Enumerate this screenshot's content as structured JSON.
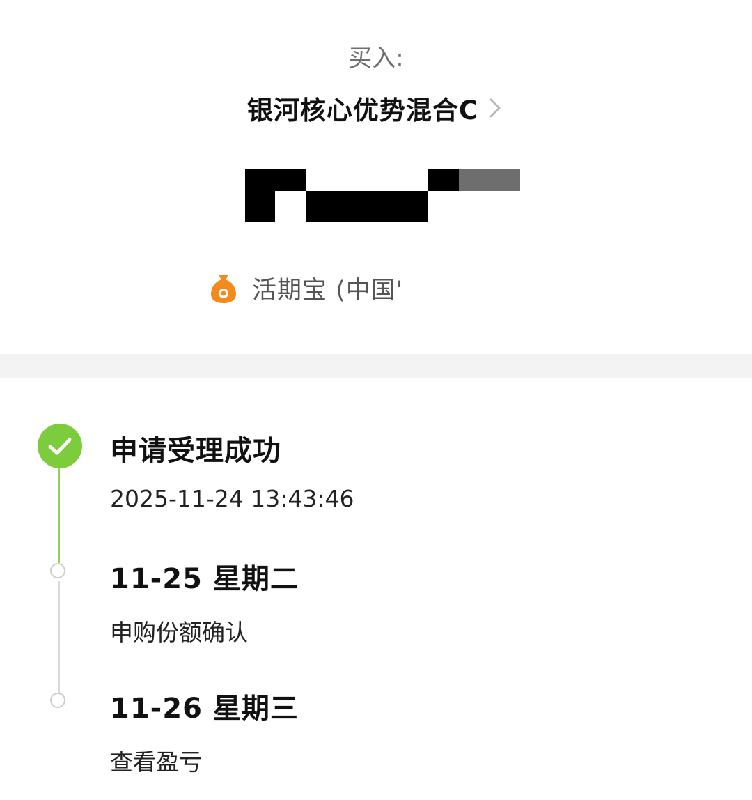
{
  "header": {
    "buy_label": "买入:",
    "fund_name": "银河核心优势混合C"
  },
  "payment": {
    "method_text": "活期宝 (中国'",
    "icon": "money-bag-icon"
  },
  "timeline": {
    "steps": [
      {
        "title": "申请受理成功",
        "subtitle": "2025-11-24 13:43:46",
        "status": "done"
      },
      {
        "title": "11-25 星期二",
        "subtitle": "申购份额确认",
        "status": "pending"
      },
      {
        "title": "11-26 星期三",
        "subtitle": "查看盈亏",
        "status": "pending"
      }
    ]
  },
  "colors": {
    "success": "#7ccc3e",
    "divider": "#f3f3f3",
    "accent_orange": "#f28a1e"
  }
}
